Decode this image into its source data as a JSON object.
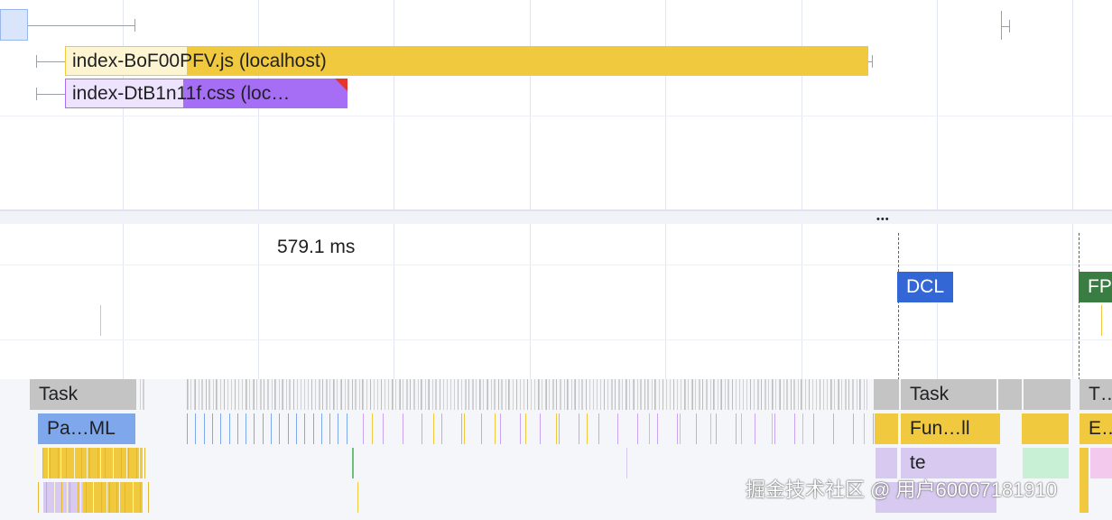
{
  "network": {
    "requests": [
      {
        "name": "index-BoF00PFV.js (localhost)",
        "color": "#f0c93f",
        "light": "#fdf4d2"
      },
      {
        "name": "index-DtB1n11f.css (loc…",
        "color": "#a66ef5",
        "light": "#eee3fc"
      }
    ]
  },
  "splitter": {
    "more": "•••"
  },
  "timings": {
    "time_label": "579.1 ms",
    "markers": [
      {
        "label": "DCL",
        "color": "#3367d6"
      },
      {
        "label": "FP",
        "color": "#3a7d43"
      }
    ]
  },
  "main": {
    "tasks": [
      {
        "label": "Task"
      },
      {
        "label": "Task"
      },
      {
        "label": "T…"
      }
    ],
    "calls": [
      {
        "label": "Pa…ML",
        "color": "#7fa8ec"
      },
      {
        "label": "Fun…ll",
        "color": "#f0c93f"
      },
      {
        "label": "E…",
        "color": "#f0c93f"
      }
    ],
    "sub": [
      {
        "label": "te",
        "color": "#d7c9ef"
      }
    ]
  },
  "watermark": "掘金技术社区 @ 用户60007181910",
  "colors": {
    "task": "#c4c4c4",
    "script": "#f0c93f",
    "parse": "#7fa8ec",
    "style": "#d7c9ef",
    "green": "#c8f0d4"
  }
}
